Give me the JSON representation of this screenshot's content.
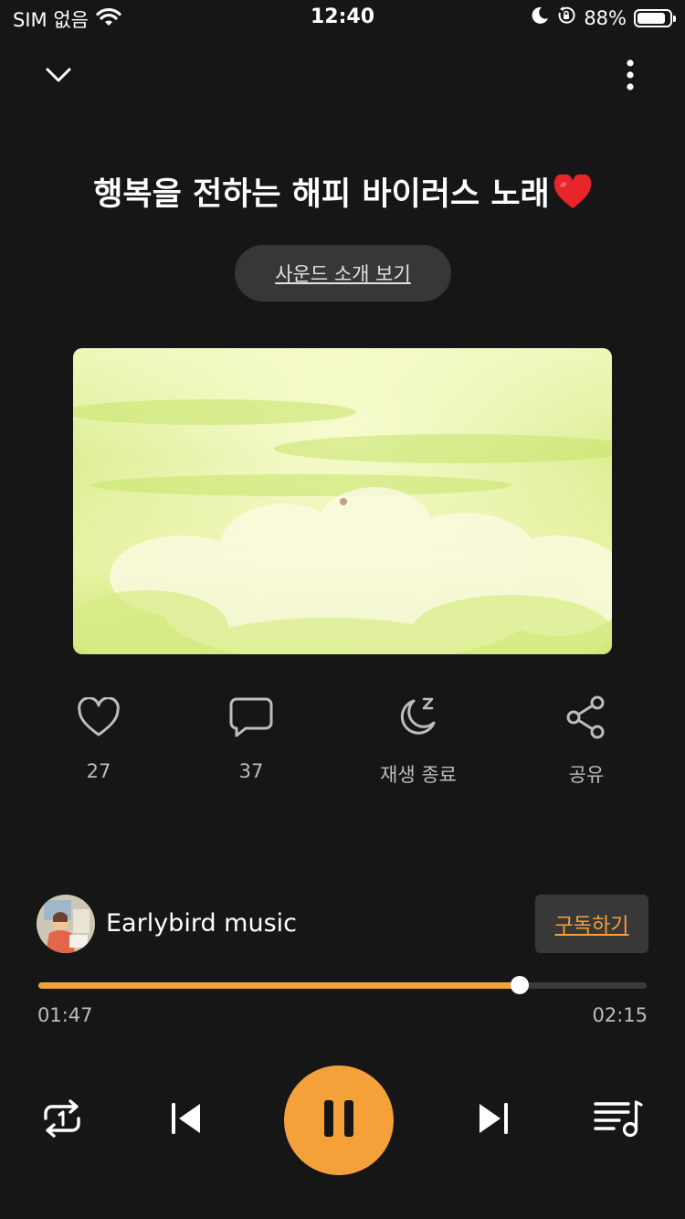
{
  "status_bar": {
    "carrier": "SIM 없음",
    "time": "12:40",
    "battery_percent": "88%",
    "battery_level": 0.88,
    "icons": [
      "wifi-icon",
      "moon-icon",
      "orientation-lock-icon",
      "battery-icon"
    ]
  },
  "player": {
    "title": "행복을 전하는 해피 바이러스 노래",
    "title_emoji": "heart-emoji",
    "intro_button": "사운드 소개 보기",
    "actions": {
      "like": "27",
      "comment": "37",
      "sleep_timer": "재생 종료",
      "share": "공유"
    },
    "channel": {
      "name": "Earlybird music",
      "subscribe_label": "구독하기"
    },
    "progress": {
      "elapsed": "01:47",
      "total": "02:15",
      "fraction": 0.792
    },
    "controls": [
      "repeat-one-icon",
      "previous-icon",
      "pause-icon",
      "next-icon",
      "playlist-icon"
    ]
  },
  "colors": {
    "accent": "#f5a13a",
    "background": "#161616",
    "button_bg": "#373737"
  }
}
